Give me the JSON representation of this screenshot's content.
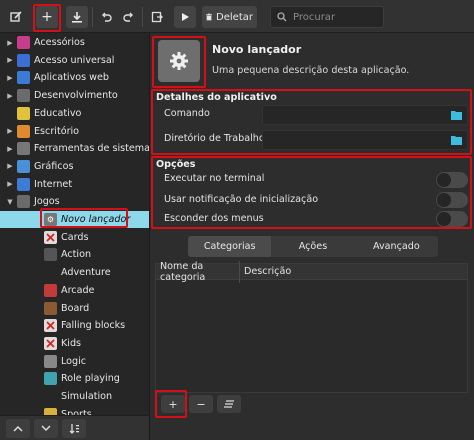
{
  "toolbar": {
    "delete_label": "Deletar",
    "search_placeholder": "Procurar"
  },
  "sidebar": {
    "items": [
      {
        "label": "Acessórios",
        "icon": "accessories-icon",
        "color": "#c83c8c",
        "indent": 0,
        "arrow": "right"
      },
      {
        "label": "Acesso universal",
        "icon": "accessibility-icon",
        "color": "#3b6fd6",
        "indent": 0,
        "arrow": "right"
      },
      {
        "label": "Aplicativos web",
        "icon": "web-apps-icon",
        "color": "#3a7bd5",
        "indent": 0,
        "arrow": "right"
      },
      {
        "label": "Desenvolvimento",
        "icon": "development-icon",
        "color": "#6b6b6b",
        "indent": 0,
        "arrow": "right"
      },
      {
        "label": "Educativo",
        "icon": "education-icon",
        "color": "#e0c33a",
        "indent": 0,
        "arrow": "none"
      },
      {
        "label": "Escritório",
        "icon": "office-icon",
        "color": "#e08a2f",
        "indent": 0,
        "arrow": "right"
      },
      {
        "label": "Ferramentas de sistema",
        "icon": "system-tools-icon",
        "color": "#777777",
        "indent": 0,
        "arrow": "right"
      },
      {
        "label": "Gráficos",
        "icon": "graphics-icon",
        "color": "#4a90d9",
        "indent": 0,
        "arrow": "right"
      },
      {
        "label": "Internet",
        "icon": "internet-icon",
        "color": "#3d7bd4",
        "indent": 0,
        "arrow": "right"
      },
      {
        "label": "Jogos",
        "icon": "games-icon",
        "color": "#6a6a6a",
        "indent": 0,
        "arrow": "down"
      },
      {
        "label": "Novo lançador",
        "icon": "gear-icon",
        "color": "#777777",
        "indent": 1,
        "arrow": "none",
        "selected": true
      },
      {
        "label": "Cards",
        "icon": "cards-icon",
        "color": "#dddddd",
        "indent": 1,
        "arrow": "none"
      },
      {
        "label": "Action",
        "icon": "action-icon",
        "color": "#555555",
        "indent": 1,
        "arrow": "none"
      },
      {
        "label": "Adventure",
        "icon": "",
        "color": "",
        "indent": 1,
        "arrow": "none"
      },
      {
        "label": "Arcade",
        "icon": "arcade-icon",
        "color": "#c23b3b",
        "indent": 1,
        "arrow": "none"
      },
      {
        "label": "Board",
        "icon": "board-icon",
        "color": "#8a5a34",
        "indent": 1,
        "arrow": "none"
      },
      {
        "label": "Falling blocks",
        "icon": "falling-blocks-icon",
        "color": "#dddddd",
        "indent": 1,
        "arrow": "none"
      },
      {
        "label": "Kids",
        "icon": "kids-icon",
        "color": "#dddddd",
        "indent": 1,
        "arrow": "none"
      },
      {
        "label": "Logic",
        "icon": "logic-icon",
        "color": "#888888",
        "indent": 1,
        "arrow": "none"
      },
      {
        "label": "Role playing",
        "icon": "role-playing-icon",
        "color": "#3fa3b0",
        "indent": 1,
        "arrow": "none"
      },
      {
        "label": "Simulation",
        "icon": "",
        "color": "",
        "indent": 1,
        "arrow": "none"
      },
      {
        "label": "Sports",
        "icon": "sports-icon",
        "color": "#d8b13a",
        "indent": 1,
        "arrow": "none"
      }
    ]
  },
  "launcher": {
    "name": "Novo lançador",
    "description": "Uma pequena descrição desta aplicação."
  },
  "details": {
    "title": "Detalhes do aplicativo",
    "command_label": "Comando",
    "command_value": "",
    "workdir_label": "Diretório de Trabalho",
    "workdir_value": ""
  },
  "options": {
    "title": "Opções",
    "items": [
      {
        "label": "Executar no terminal",
        "enabled": false
      },
      {
        "label": "Usar notificação de inicialização",
        "enabled": false
      },
      {
        "label": "Esconder dos menus",
        "enabled": false
      }
    ]
  },
  "tabs": [
    {
      "label": "Categorias",
      "active": true
    },
    {
      "label": "Ações",
      "active": false
    },
    {
      "label": "Avançado",
      "active": false
    }
  ],
  "table": {
    "columns": [
      "Nome da categoria",
      "Descrição"
    ],
    "rows": []
  },
  "colors": {
    "highlight_red": "#d40f15",
    "selection": "#8ed8ec",
    "folder_accent": "#3dbde0"
  }
}
